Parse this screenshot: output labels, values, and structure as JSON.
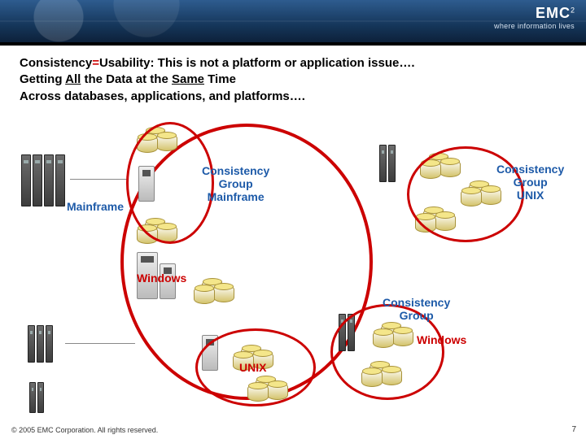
{
  "banner": {
    "brand": "EMC",
    "sup": "2",
    "tagline": "where information lives"
  },
  "title": {
    "line1a": "Consistency",
    "line1b": "Usability: This is not a platform or application issue….",
    "line2a": "Getting ",
    "line2b": "All",
    "line2c": " the Data at the ",
    "line2d": "Same",
    "line2e": " Time",
    "line3": "Across databases, applications, and platforms…."
  },
  "labels": {
    "mainframe": "Mainframe",
    "windows": "Windows",
    "unix": "UNIX",
    "cg_mainframe_l1": "Consistency",
    "cg_mainframe_l2": "Group",
    "cg_mainframe_l3": "Mainframe",
    "cg_unix_l1": "Consistency",
    "cg_unix_l2": "Group",
    "cg_unix_l3": "UNIX",
    "cg_win_l1": "Consistency",
    "cg_win_l2": "Group",
    "cg_win_l3": "Windows"
  },
  "footer": {
    "copyright": "© 2005 EMC Corporation. All rights reserved.",
    "page": "7"
  }
}
